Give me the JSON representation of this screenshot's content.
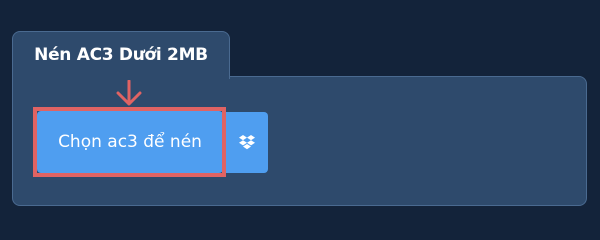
{
  "tab": {
    "title": "Nén AC3 Dưới 2MB"
  },
  "upload": {
    "choose_label": "Chọn ac3 để nén",
    "dropbox_icon": "dropbox-icon",
    "arrow_icon": "arrow-down-icon"
  },
  "colors": {
    "background": "#13233a",
    "panel": "#2e4a6c",
    "button": "#4f9ef0",
    "highlight": "#e06363"
  }
}
